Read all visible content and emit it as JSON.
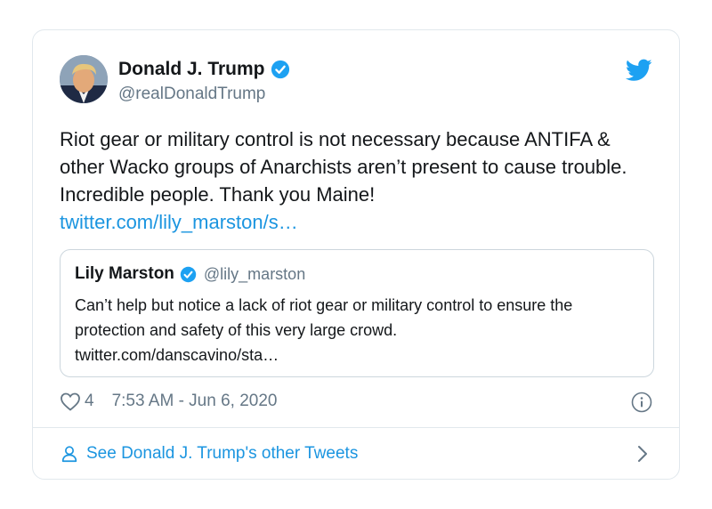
{
  "tweet": {
    "display_name": "Donald J. Trump",
    "handle": "@realDonaldTrump",
    "text": "Riot gear or military control is not necessary because ANTIFA & other Wacko groups of Anarchists aren’t present to cause trouble. Incredible people. Thank you Maine!",
    "link": "twitter.com/lily_marston/s…",
    "likes": "4",
    "timestamp": "7:53 AM - Jun 6, 2020"
  },
  "quote": {
    "display_name": "Lily Marston",
    "handle": "@lily_marston",
    "text": "Can’t help but notice a lack of riot gear or military control to ensure the protection and safety of this very large crowd.",
    "link": "twitter.com/danscavino/sta…"
  },
  "footer": {
    "label": "See Donald J. Trump's other Tweets"
  },
  "icons": {
    "verified": "verified-badge-icon",
    "brand": "twitter-bird-icon",
    "like": "heart-icon",
    "info": "info-icon",
    "person": "person-icon",
    "chevron": "chevron-right-icon"
  },
  "colors": {
    "link": "#1b95e0",
    "secondary_text": "#657786",
    "border": "#e1e8ed",
    "verified": "#1da1f2"
  }
}
